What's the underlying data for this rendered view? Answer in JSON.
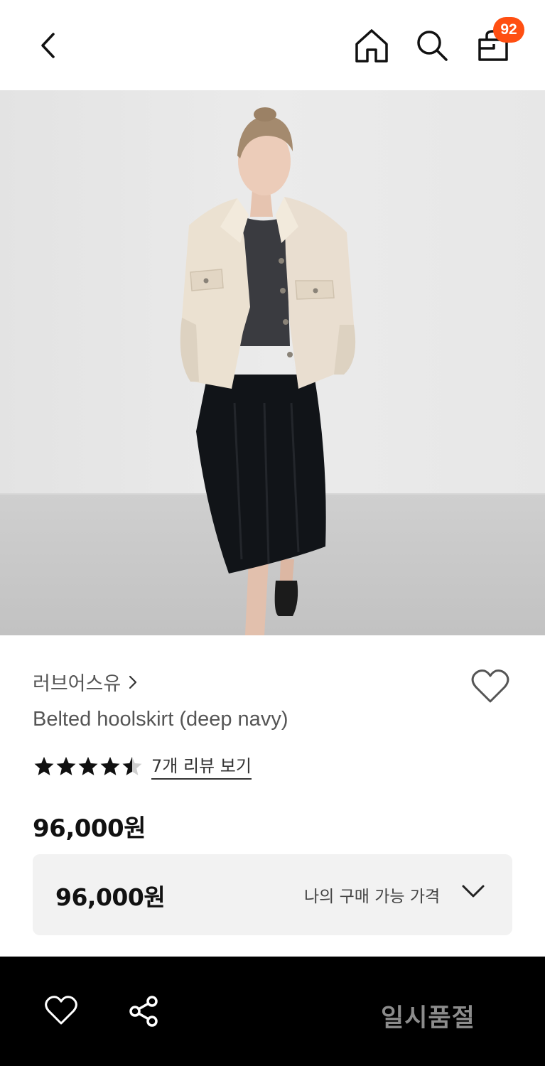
{
  "header": {
    "cart_count": "92"
  },
  "product": {
    "brand": "러브어스유",
    "title": "Belted hoolskirt (deep navy)",
    "rating": 4.5,
    "review_link": "7개 리뷰 보기",
    "price": "96,000원"
  },
  "my_price": {
    "value": "96,000원",
    "label": "나의 구매 가능 가격"
  },
  "bottom_bar": {
    "status": "일시품절"
  },
  "colors": {
    "badge": "#ff4f12",
    "bottom_bar_bg": "#000000",
    "soldout_text": "#8c8c8c",
    "price_box_bg": "#f2f2f2"
  },
  "icons": [
    "back-icon",
    "home-icon",
    "search-icon",
    "shopping-bag-icon",
    "heart-icon",
    "star-icon",
    "share-icon",
    "chevron-right-icon",
    "chevron-down-icon"
  ]
}
